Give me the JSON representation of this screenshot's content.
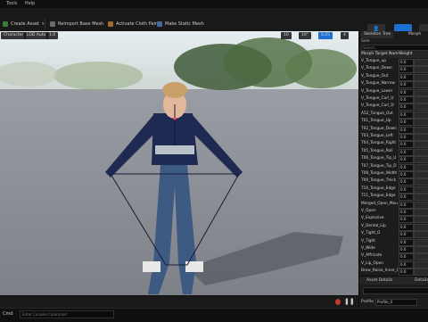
{
  "menu": [
    "Tools",
    "Help"
  ],
  "toolbar": {
    "create_asset": "Create Asset",
    "reimport": "Reimport Base Mesh",
    "activate_cloth": "Activate Cloth Paint",
    "make_static": "Make Static Mesh"
  },
  "viewport": {
    "character_label": "Character",
    "lod_label": "LOD Auto",
    "fov_label": "1.0",
    "snap1": "10",
    "snap2": "10°",
    "snap3": "0.25",
    "camera_speed": "4"
  },
  "panel": {
    "tab1": "Skeleton Tree",
    "tab2": "Morph",
    "section": "Sele",
    "search_placeholder": "Search",
    "col_name": "Morph Target Nam",
    "col_weight": "Weight",
    "rows": [
      {
        "name": "V_Tongue_up",
        "weight": "0.0"
      },
      {
        "name": "V_Tongue_Down",
        "weight": "0.0"
      },
      {
        "name": "V_Tongue_Out",
        "weight": "0.0"
      },
      {
        "name": "V_Tongue_Narrow",
        "weight": "0.0"
      },
      {
        "name": "V_Tongue_Lower",
        "weight": "0.0"
      },
      {
        "name": "V_Tongue_Curl_U",
        "weight": "0.0"
      },
      {
        "name": "V_Tongue_Curl_D",
        "weight": "0.0"
      },
      {
        "name": "A52_Tongue_Out",
        "weight": "0.0"
      },
      {
        "name": "T01_Tongue_Up",
        "weight": "0.0"
      },
      {
        "name": "T02_Tongue_Down",
        "weight": "0.0"
      },
      {
        "name": "T03_Tongue_Left",
        "weight": "0.0"
      },
      {
        "name": "T04_Tongue_Right",
        "weight": "0.0"
      },
      {
        "name": "T05_Tongue_Roll",
        "weight": "0.0"
      },
      {
        "name": "T06_Tongue_Tip_U",
        "weight": "0.0"
      },
      {
        "name": "T07_Tongue_Tip_D",
        "weight": "0.0"
      },
      {
        "name": "T08_Tongue_Width",
        "weight": "0.0"
      },
      {
        "name": "T09_Tongue_Thick",
        "weight": "0.0"
      },
      {
        "name": "T10_Tongue_Edge",
        "weight": "0.0"
      },
      {
        "name": "T11_Tongue_Edge",
        "weight": "0.0"
      },
      {
        "name": "Merged_Open_Mou",
        "weight": "0.0"
      },
      {
        "name": "V_Open",
        "weight": "0.0"
      },
      {
        "name": "V_Explosive",
        "weight": "0.0"
      },
      {
        "name": "V_Dental_Lip",
        "weight": "0.0"
      },
      {
        "name": "V_Tight_O",
        "weight": "0.0"
      },
      {
        "name": "V_Tight",
        "weight": "0.0"
      },
      {
        "name": "V_Wide",
        "weight": "0.0"
      },
      {
        "name": "V_Affricate",
        "weight": "0.0"
      },
      {
        "name": "V_Lip_Open",
        "weight": "0.0"
      },
      {
        "name": "Brow_Raise_Inner_L",
        "weight": "0.0"
      }
    ],
    "asset_details": "Asset Details",
    "details_tab": "Details",
    "profile_label": "Profile",
    "profile_value": "Profile_0"
  },
  "status": {
    "cmd_label": "Cmd",
    "cmd_placeholder": "Enter Console Command"
  }
}
